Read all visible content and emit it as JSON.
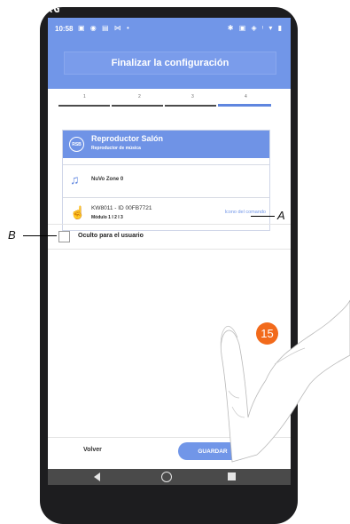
{
  "phone": {
    "corner_logo": "XG"
  },
  "status_bar": {
    "time": "10:58",
    "left_icons": "▣ ◉ ▤ ⋈ •",
    "right_icons": "✱ ▣ ◈ ᵎ ▾ ▮"
  },
  "header": {
    "title": "Finalizar la configuración"
  },
  "stepper": {
    "steps": [
      "1",
      "2",
      "3",
      "4"
    ],
    "active_step": 4
  },
  "card": {
    "icon_text": "RSB",
    "title": "Reproductor Salón",
    "subtitle": "Reproductor de música",
    "zone_label": "NuVo Zone 0",
    "command_device": "KW8011 - ID 00FB7721",
    "command_module": "Módulo 1 I 2 I 3",
    "command_icon_action": "Icono del comando"
  },
  "hidden_toggle": {
    "label": "Oculto para el usuario",
    "checked": false
  },
  "footer": {
    "back_label": "Volver",
    "save_label": "GUARDAR"
  },
  "annotations": {
    "callout_a": "A",
    "callout_b": "B",
    "step_badge": "15"
  },
  "colors": {
    "accent": "#7196e8",
    "header": "#7196e8",
    "badge": "#f26a1b"
  }
}
